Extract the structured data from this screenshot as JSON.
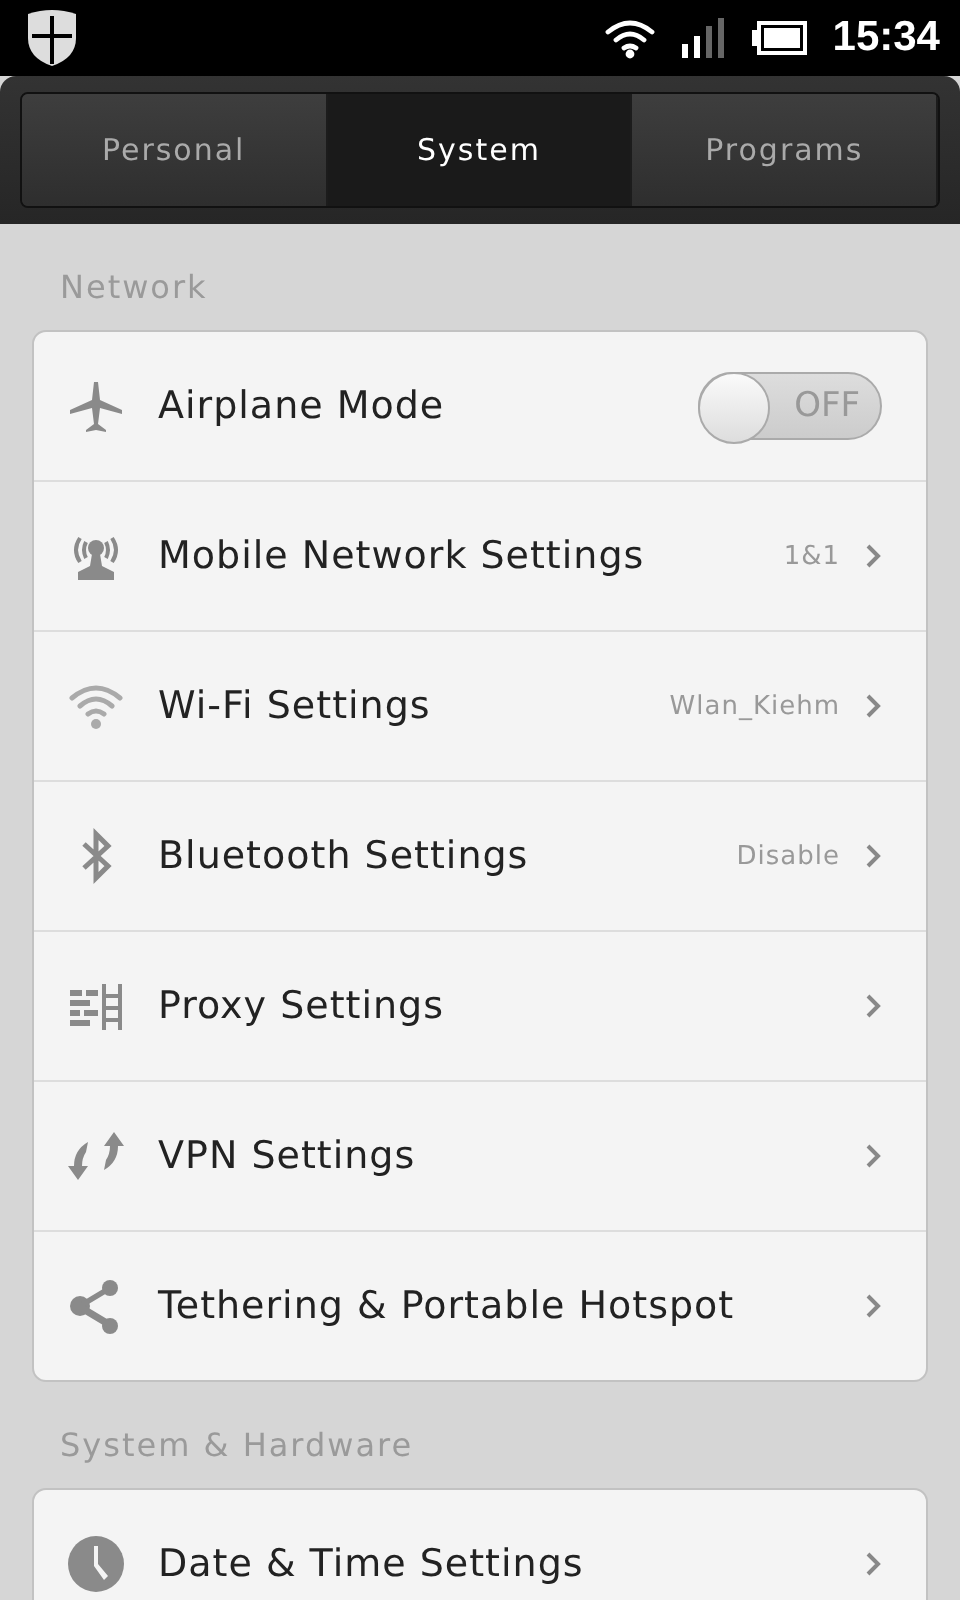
{
  "status_bar": {
    "time": "15:34"
  },
  "tabs": [
    {
      "label": "Personal",
      "selected": false
    },
    {
      "label": "System",
      "selected": true
    },
    {
      "label": "Programs",
      "selected": false
    }
  ],
  "sections": [
    {
      "title": "Network",
      "items": [
        {
          "kind": "toggle",
          "label": "Airplane Mode",
          "toggle": {
            "on": false,
            "label": "OFF"
          }
        },
        {
          "kind": "link",
          "label": "Mobile Network Settings",
          "value": "1&1"
        },
        {
          "kind": "link",
          "label": "Wi-Fi Settings",
          "value": "Wlan_Kiehm"
        },
        {
          "kind": "link",
          "label": "Bluetooth Settings",
          "value": "Disable"
        },
        {
          "kind": "link",
          "label": "Proxy Settings"
        },
        {
          "kind": "link",
          "label": "VPN Settings"
        },
        {
          "kind": "link",
          "label": "Tethering & Portable Hotspot"
        }
      ]
    },
    {
      "title": "System & Hardware",
      "items": [
        {
          "kind": "link",
          "label": "Date & Time Settings"
        }
      ]
    }
  ]
}
